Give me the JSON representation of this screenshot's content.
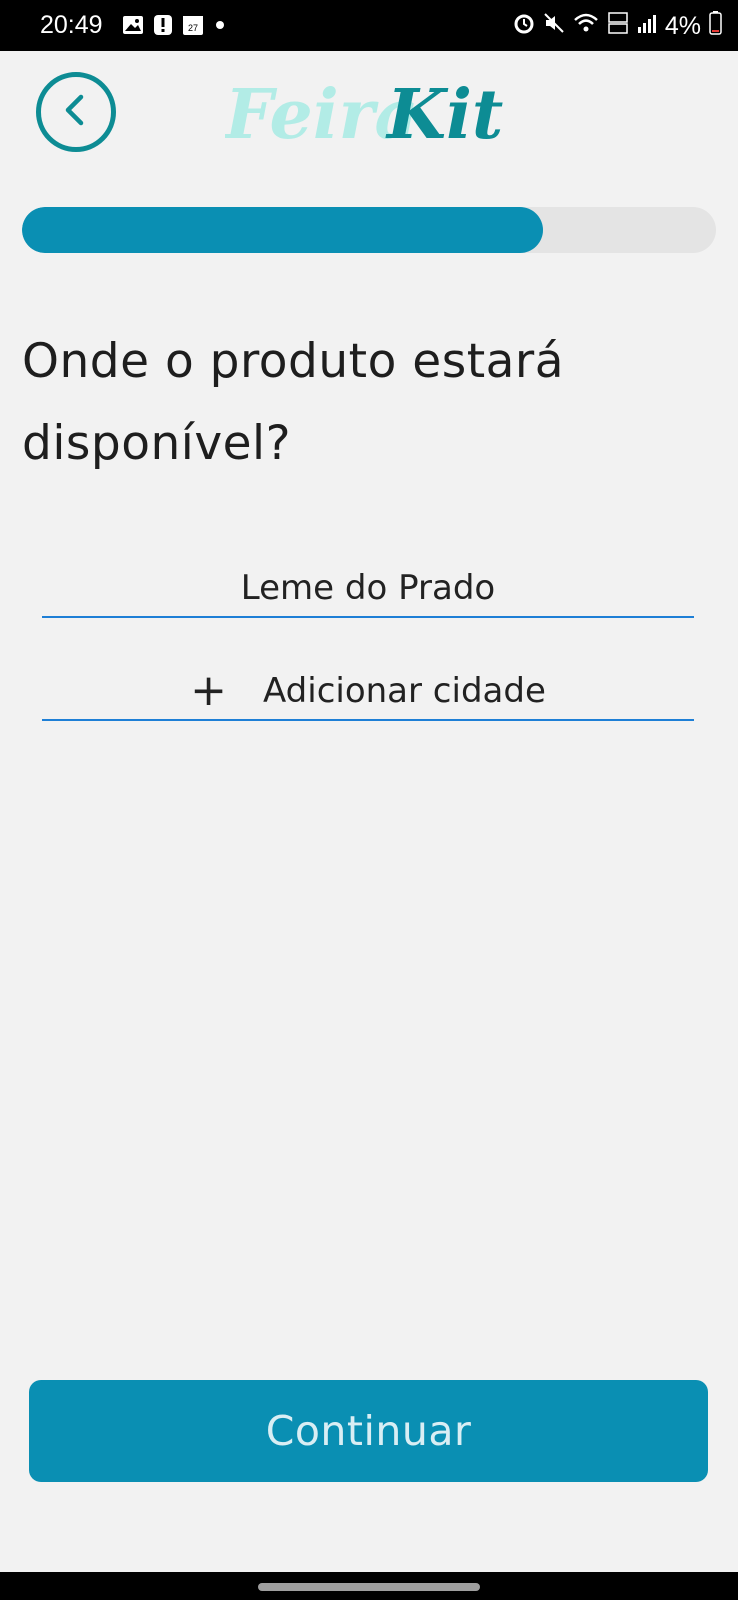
{
  "status_bar": {
    "time": "20:49",
    "calendar_day": "27",
    "battery": "4%",
    "left_icons": [
      "gallery-icon",
      "alert-icon",
      "calendar-icon",
      "dot-icon"
    ],
    "right_icons": [
      "alarm-icon",
      "mute-icon",
      "wifi-icon",
      "volte-icon",
      "signal-icon",
      "battery-icon"
    ]
  },
  "header": {
    "logo_part1": "Feira",
    "logo_part2": "Kit",
    "back_icon": "chevron-left-icon"
  },
  "progress": {
    "value": 0.75
  },
  "main": {
    "title_line1": "Onde o produto estará",
    "title_line2": "disponível?",
    "cities": [
      "Leme do Prado"
    ],
    "add_city_label": "Adicionar cidade",
    "add_icon": "+"
  },
  "footer": {
    "continue_label": "Continuar"
  },
  "colors": {
    "accent": "#0a8fb3",
    "logo_light": "#b2ece6",
    "logo_dark": "#0d8c94",
    "underline": "#1e7fd6",
    "background": "#f2f2f2"
  }
}
